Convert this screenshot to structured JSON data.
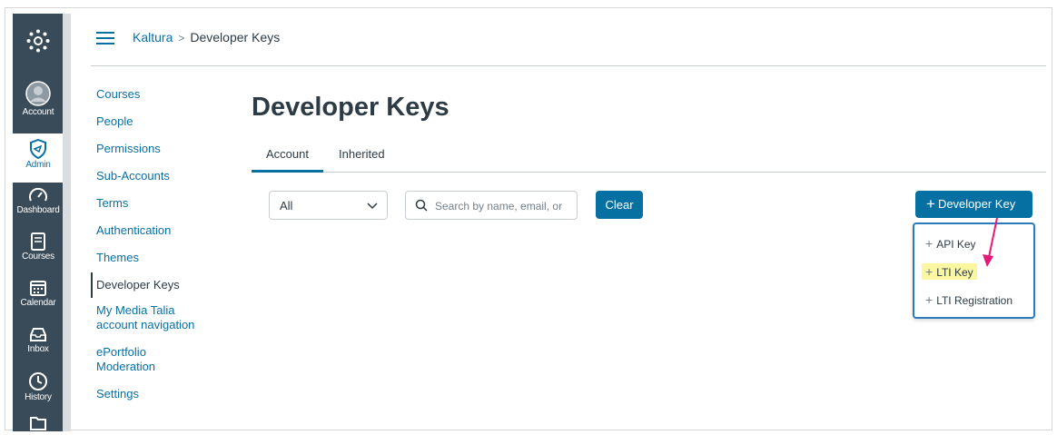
{
  "breadcrumb": {
    "account": "Kaltura",
    "separator": ">",
    "current": "Developer Keys"
  },
  "global_nav": [
    {
      "icon": "account-icon",
      "label": "Account"
    },
    {
      "icon": "admin-icon",
      "label": "Admin"
    },
    {
      "icon": "dashboard-icon",
      "label": "Dashboard"
    },
    {
      "icon": "courses-icon",
      "label": "Courses"
    },
    {
      "icon": "calendar-icon",
      "label": "Calendar"
    },
    {
      "icon": "inbox-icon",
      "label": "Inbox"
    },
    {
      "icon": "history-icon",
      "label": "History"
    }
  ],
  "subnav": {
    "courses": "Courses",
    "people": "People",
    "permissions": "Permissions",
    "sub_accounts": "Sub-Accounts",
    "terms": "Terms",
    "authentication": "Authentication",
    "themes": "Themes",
    "developer_keys": "Developer Keys",
    "my_media_1": "My Media Talia",
    "my_media_2": "account navigation",
    "eportfolio_1": "ePortfolio",
    "eportfolio_2": "Moderation",
    "settings": "Settings"
  },
  "page": {
    "title": "Developer Keys"
  },
  "tabs": {
    "account": "Account",
    "inherited": "Inherited"
  },
  "filter": {
    "selected": "All"
  },
  "search": {
    "placeholder": "Search by name, email, or"
  },
  "buttons": {
    "clear": "Clear",
    "developer_key": "Developer Key"
  },
  "menu": {
    "api_key": "API Key",
    "lti_key": "LTI Key",
    "lti_registration": "LTI Registration"
  },
  "colors": {
    "brand": "#0770a3",
    "nav_bg": "#394b58",
    "highlight": "#fbf7a0",
    "annotation_arrow": "#e6197a"
  }
}
